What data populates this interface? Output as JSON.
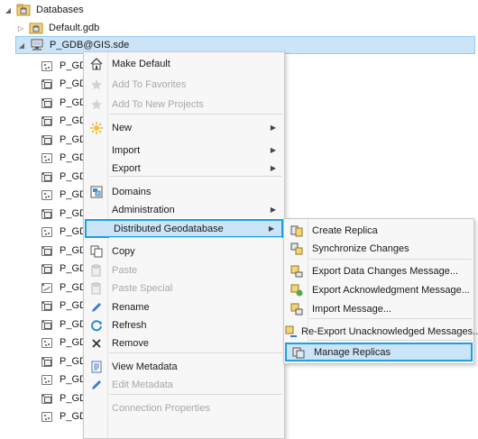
{
  "tree": {
    "root_label": "Databases",
    "items": [
      {
        "label": "Default.gdb"
      },
      {
        "label": "P_GDB@GIS.sde",
        "selected": true
      }
    ],
    "children_label": "P_GDB",
    "children": [
      "pt",
      "ply",
      "ply",
      "ply",
      "ply",
      "pt",
      "ply",
      "pt",
      "ply",
      "pt",
      "ply",
      "ply",
      "ln",
      "ply",
      "ply",
      "pt",
      "ply",
      "pt",
      "ply",
      "pt"
    ]
  },
  "menu": {
    "items": [
      {
        "label": "Make Default",
        "icon": "home-icon"
      },
      {
        "label": "Add To Favorites",
        "icon": "star-icon",
        "disabled": true
      },
      {
        "label": "Add To New Projects",
        "icon": "star-icon",
        "disabled": true
      },
      {
        "label": "New",
        "icon": "new-icon",
        "submenu": true
      },
      {
        "label": "Import",
        "submenu": true
      },
      {
        "label": "Export",
        "submenu": true
      },
      {
        "label": "Domains",
        "icon": "domains-icon"
      },
      {
        "label": "Administration",
        "submenu": true
      },
      {
        "label": "Distributed Geodatabase",
        "submenu": true,
        "highlighted": true
      },
      {
        "label": "Copy",
        "icon": "copy-icon"
      },
      {
        "label": "Paste",
        "icon": "paste-icon",
        "disabled": true
      },
      {
        "label": "Paste Special",
        "icon": "paste-icon",
        "disabled": true
      },
      {
        "label": "Rename",
        "icon": "pencil-icon"
      },
      {
        "label": "Refresh",
        "icon": "refresh-icon"
      },
      {
        "label": "Remove",
        "icon": "remove-icon"
      },
      {
        "label": "View Metadata",
        "icon": "metadata-icon"
      },
      {
        "label": "Edit Metadata",
        "icon": "pencil-icon",
        "disabled": true
      },
      {
        "label": "Connection Properties",
        "disabled": true
      }
    ]
  },
  "submenu": {
    "items": [
      {
        "label": "Create Replica",
        "icon": "create-replica-icon"
      },
      {
        "label": "Synchronize Changes",
        "icon": "sync-icon"
      },
      {
        "label": "Export Data Changes Message...",
        "icon": "export-data-icon"
      },
      {
        "label": "Export Acknowledgment Message...",
        "icon": "export-ack-icon"
      },
      {
        "label": "Import Message...",
        "icon": "import-message-icon"
      },
      {
        "label": "Re-Export Unacknowledged Messages...",
        "icon": "reexport-icon"
      },
      {
        "label": "Manage Replicas",
        "icon": "manage-replicas-icon",
        "highlighted": true
      }
    ]
  },
  "colors": {
    "highlight_fill": "#cce4f7",
    "highlight_border": "#1ba1e2"
  }
}
